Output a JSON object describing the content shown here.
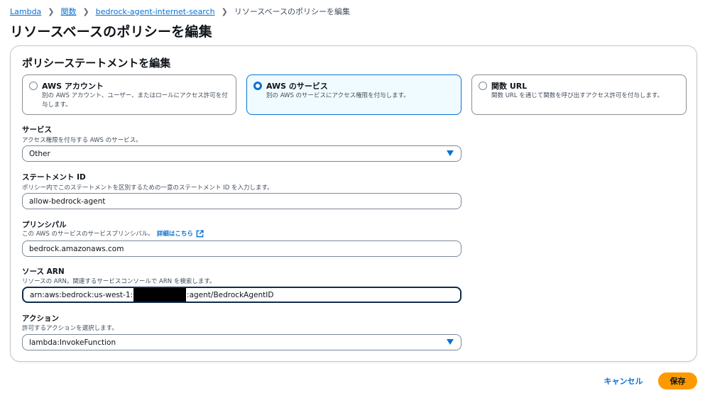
{
  "breadcrumb": {
    "items": [
      "Lambda",
      "関数",
      "bedrock-agent-internet-search"
    ],
    "current": "リソースベースのポリシーを編集"
  },
  "page_title": "リソースベースのポリシーを編集",
  "panel": {
    "title": "ポリシーステートメントを編集",
    "tiles": [
      {
        "title": "AWS アカウント",
        "description": "別の AWS アカウント、ユーザー、またはロールにアクセス許可を付与します。",
        "selected": false
      },
      {
        "title": "AWS のサービス",
        "description": "別の AWS のサービスにアクセス権限を付与します。",
        "selected": true
      },
      {
        "title": "関数 URL",
        "description": "関数 URL を通じて関数を呼び出すアクセス許可を付与します。",
        "selected": false
      }
    ]
  },
  "fields": {
    "service": {
      "label": "サービス",
      "description": "アクセス権限を付与する AWS のサービス。",
      "value": "Other"
    },
    "statement_id": {
      "label": "ステートメント ID",
      "description": "ポリシー内でこのステートメントを区別するための一意のステートメント ID を入力します。",
      "value": "allow-bedrock-agent"
    },
    "principal": {
      "label": "プリンシパル",
      "description": "この AWS のサービスのサービスプリンシパル。",
      "link": "詳細はこちら",
      "value": "bedrock.amazonaws.com"
    },
    "source_arn": {
      "label": "ソース ARN",
      "description": "リソースの ARN。関連するサービスコンソールで ARN を検索します。",
      "value_prefix": "arn:aws:bedrock:us-west-1:",
      "value_suffix": ":agent/BedrockAgentID"
    },
    "action": {
      "label": "アクション",
      "description": "許可するアクションを選択します。",
      "value": "lambda:InvokeFunction"
    }
  },
  "buttons": {
    "cancel": "キャンセル",
    "save": "保存"
  },
  "icons": {
    "external_link": "external-link-icon",
    "dropdown": "caret-down-icon"
  },
  "colors": {
    "link": "#0972d3",
    "primary_button": "#ff9900",
    "selected_tile_bg": "#f0fbff"
  }
}
